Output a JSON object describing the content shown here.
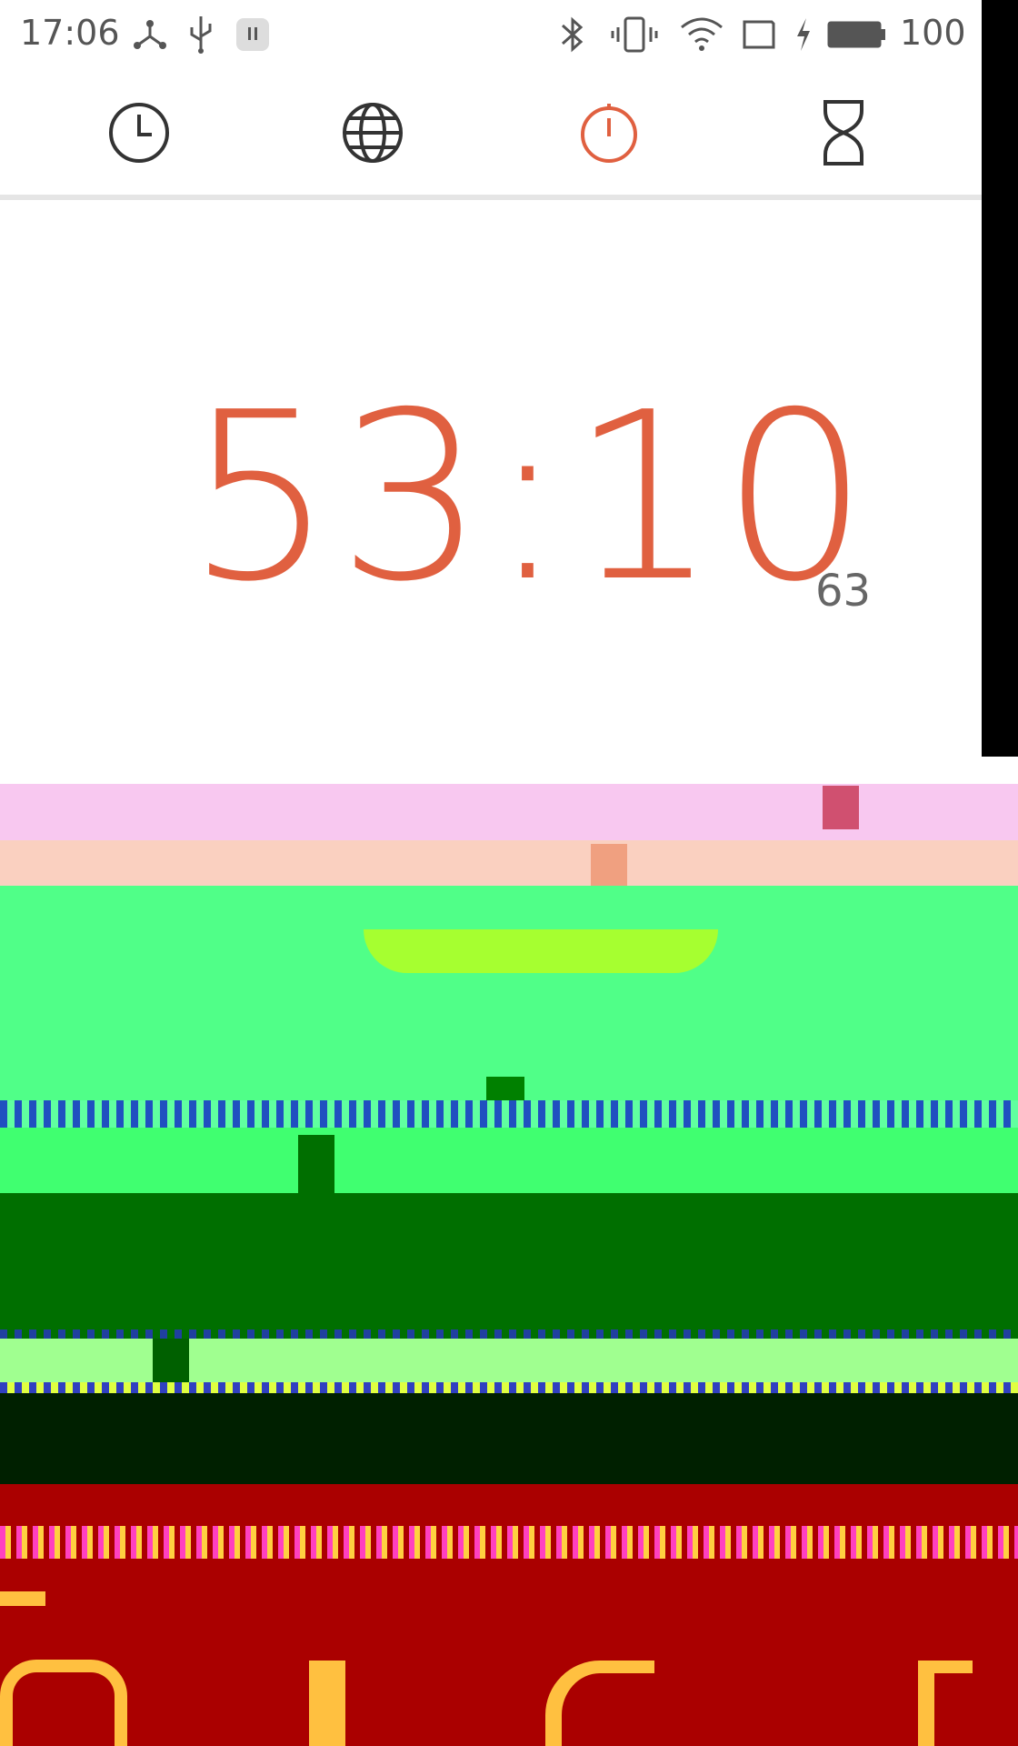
{
  "status_bar": {
    "time": "17:06",
    "battery_percent": "100",
    "icons": [
      "network-share-icon",
      "usb-icon",
      "app-notification-icon",
      "bluetooth-icon",
      "vibrate-icon",
      "wifi-icon",
      "no-sim-icon",
      "charging-icon",
      "battery-icon"
    ]
  },
  "tabs": [
    {
      "name": "alarm",
      "icon": "clock-icon",
      "active": false
    },
    {
      "name": "world-clock",
      "icon": "globe-icon",
      "active": false
    },
    {
      "name": "stopwatch",
      "icon": "stopwatch-icon",
      "active": true
    },
    {
      "name": "timer",
      "icon": "hourglass-icon",
      "active": false
    }
  ],
  "timer": {
    "main": "53:10",
    "hundredths": "63"
  },
  "colors": {
    "accent": "#e06040",
    "glitch_pink": "#f8c8f0",
    "glitch_peach": "#fad0c0",
    "glitch_green": "#50ff88",
    "glitch_dark_green": "#006f00",
    "glitch_dark_red": "#aa0000"
  }
}
